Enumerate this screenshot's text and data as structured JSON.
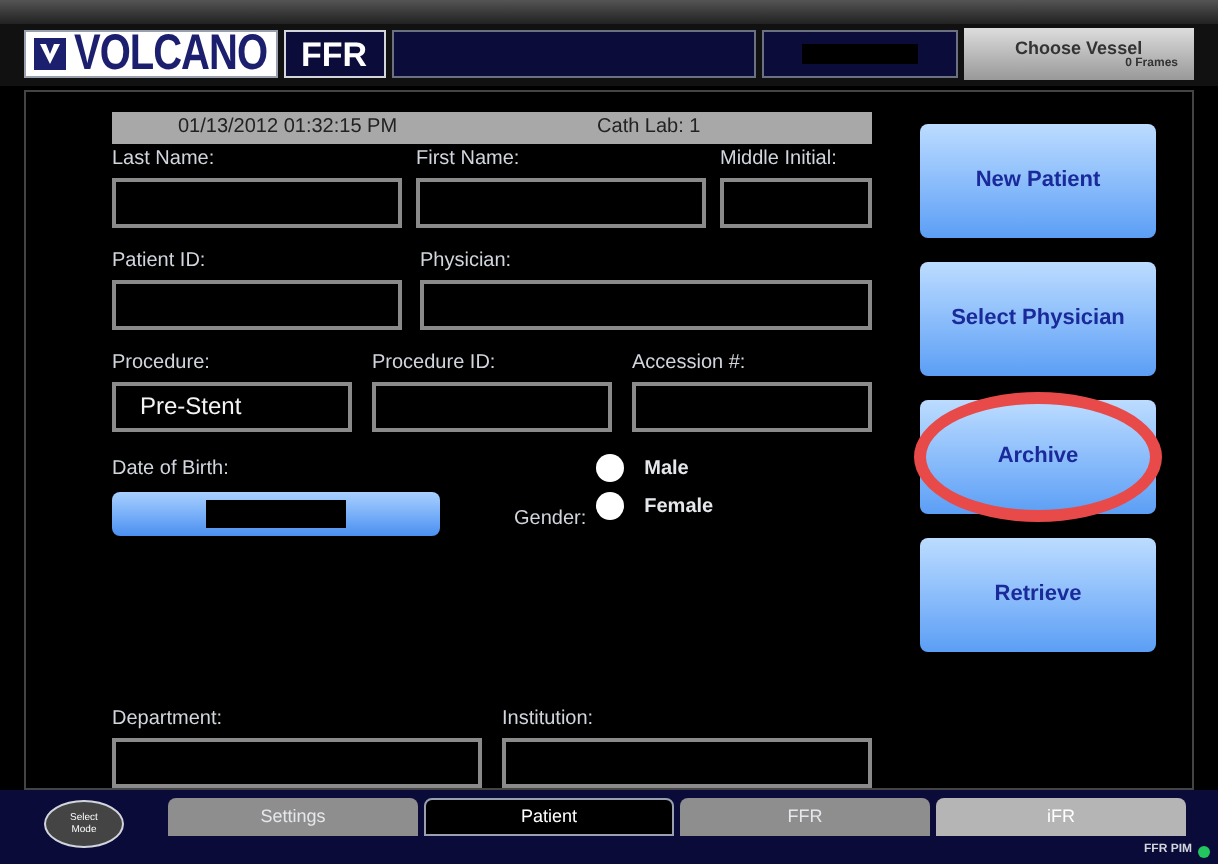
{
  "header": {
    "logo": "VOLCANO",
    "product": "FFR",
    "vessel_button": {
      "label": "Choose Vessel",
      "frames": "0 Frames"
    }
  },
  "form": {
    "date_time": "01/13/2012 01:32:15 PM",
    "cath_lab": "Cath Lab: 1",
    "rows": [
      [
        {
          "label": "Last Name:"
        },
        {
          "label": "First Name:"
        },
        {
          "label": "Middle Initial:"
        }
      ],
      [
        {
          "label": "Patient ID:"
        },
        {
          "label": "Physician:"
        }
      ],
      [
        {
          "label": "Procedure:",
          "value": "Pre-Stent"
        },
        {
          "label": "Procedure ID:"
        },
        {
          "label": "Accession #:"
        }
      ]
    ],
    "dob_label": "Date of Birth:",
    "gender_label": "Gender:",
    "genders": [
      {
        "label": "Male",
        "selected": false
      },
      {
        "label": "Female",
        "selected": false
      }
    ],
    "bottom_row": [
      {
        "label": "Department:"
      },
      {
        "label": "Institution:"
      }
    ]
  },
  "actions": [
    {
      "label": "New Patient",
      "highlighted": false
    },
    {
      "label": "Select Physician",
      "highlighted": false
    },
    {
      "label": "Archive",
      "highlighted": true
    },
    {
      "label": "Retrieve",
      "highlighted": false
    }
  ],
  "mode_button": "Select Mode",
  "tabs": [
    {
      "label": "Settings",
      "selected": false,
      "disabled": false
    },
    {
      "label": "Patient",
      "selected": true,
      "disabled": false
    },
    {
      "label": "FFR",
      "selected": false,
      "disabled": false
    },
    {
      "label": "iFR",
      "selected": false,
      "disabled": true
    }
  ],
  "status": {
    "label": "FFR PIM",
    "color": "#22c55e"
  }
}
